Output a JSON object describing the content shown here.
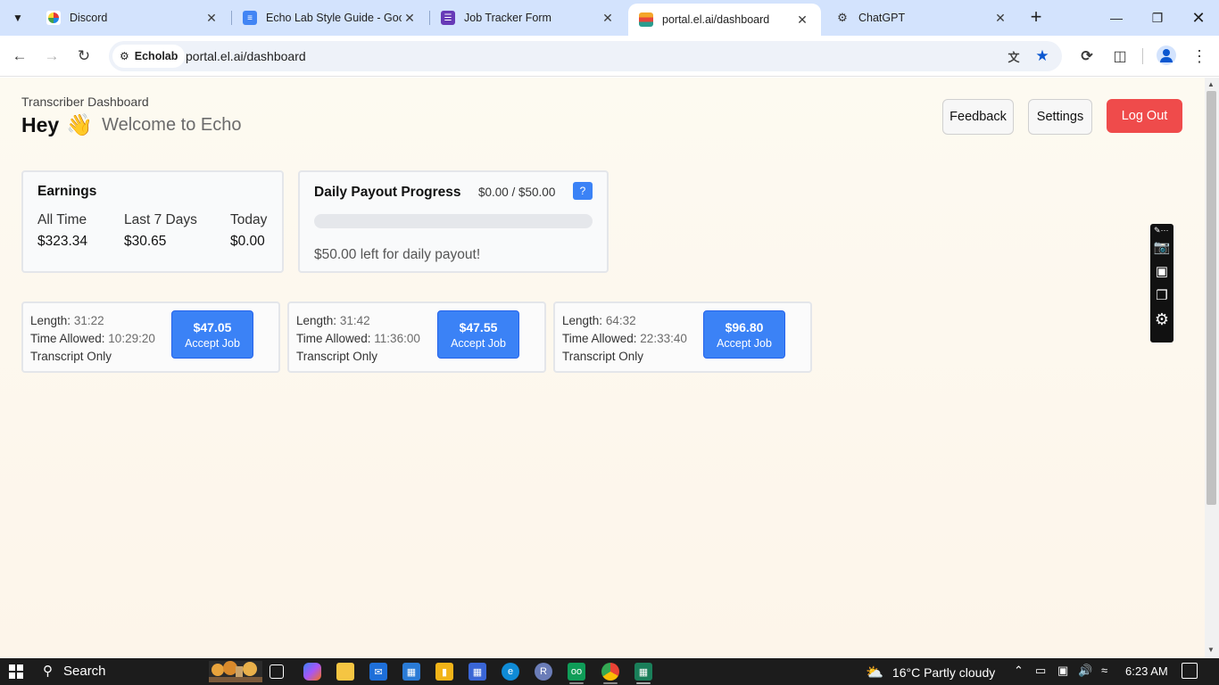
{
  "browser": {
    "tabs": [
      {
        "title": "Discord",
        "active": false
      },
      {
        "title": "Echo Lab Style Guide - Goog",
        "active": false
      },
      {
        "title": "Job Tracker Form",
        "active": false
      },
      {
        "title": "portal.el.ai/dashboard",
        "active": true
      },
      {
        "title": "ChatGPT",
        "active": false
      }
    ],
    "site_chip": "Echolab",
    "url": "portal.el.ai/dashboard"
  },
  "header": {
    "subtitle": "Transcriber Dashboard",
    "greeting": "Hey",
    "wave": "👋",
    "welcome": "Welcome to Echo",
    "buttons": {
      "feedback": "Feedback",
      "settings": "Settings",
      "logout": "Log Out"
    }
  },
  "earnings": {
    "title": "Earnings",
    "columns": [
      {
        "label": "All Time",
        "value": "$323.34"
      },
      {
        "label": "Last 7 Days",
        "value": "$30.65"
      },
      {
        "label": "Today",
        "value": "$0.00"
      }
    ]
  },
  "payout": {
    "title": "Daily Payout Progress",
    "amount": "$0.00 / $50.00",
    "help": "?",
    "progress_fraction": 0,
    "remaining": "$50.00 left for daily payout!"
  },
  "jobs": {
    "length_label": "Length:",
    "time_label": "Time Allowed:",
    "items": [
      {
        "length": "31:22",
        "time_allowed": "10:29:20",
        "type": "Transcript Only",
        "price": "$47.05",
        "action": "Accept Job"
      },
      {
        "length": "31:42",
        "time_allowed": "11:36:00",
        "type": "Transcript Only",
        "price": "$47.55",
        "action": "Accept Job"
      },
      {
        "length": "64:32",
        "time_allowed": "22:33:40",
        "type": "Transcript Only",
        "price": "$96.80",
        "action": "Accept Job"
      }
    ]
  },
  "taskbar": {
    "search": "Search",
    "weather": "16°C  Partly cloudy",
    "time": "6:23 AM"
  },
  "colors": {
    "accent": "#3b82f6",
    "danger": "#ef4b4b",
    "tab_strip": "#d3e3fd"
  }
}
